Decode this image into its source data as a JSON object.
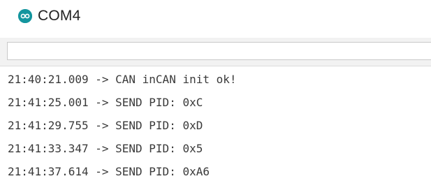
{
  "window": {
    "title": "COM4",
    "app_icon": "arduino-infinity-icon",
    "icon_color": "#14959e"
  },
  "send_input": {
    "value": ""
  },
  "output": {
    "lines": [
      "21:40:21.009 -> CAN inCAN init ok!",
      "21:41:25.001 -> SEND PID: 0xC",
      "21:41:29.755 -> SEND PID: 0xD",
      "21:41:33.347 -> SEND PID: 0x5",
      "21:41:37.614 -> SEND PID: 0xA6"
    ]
  }
}
